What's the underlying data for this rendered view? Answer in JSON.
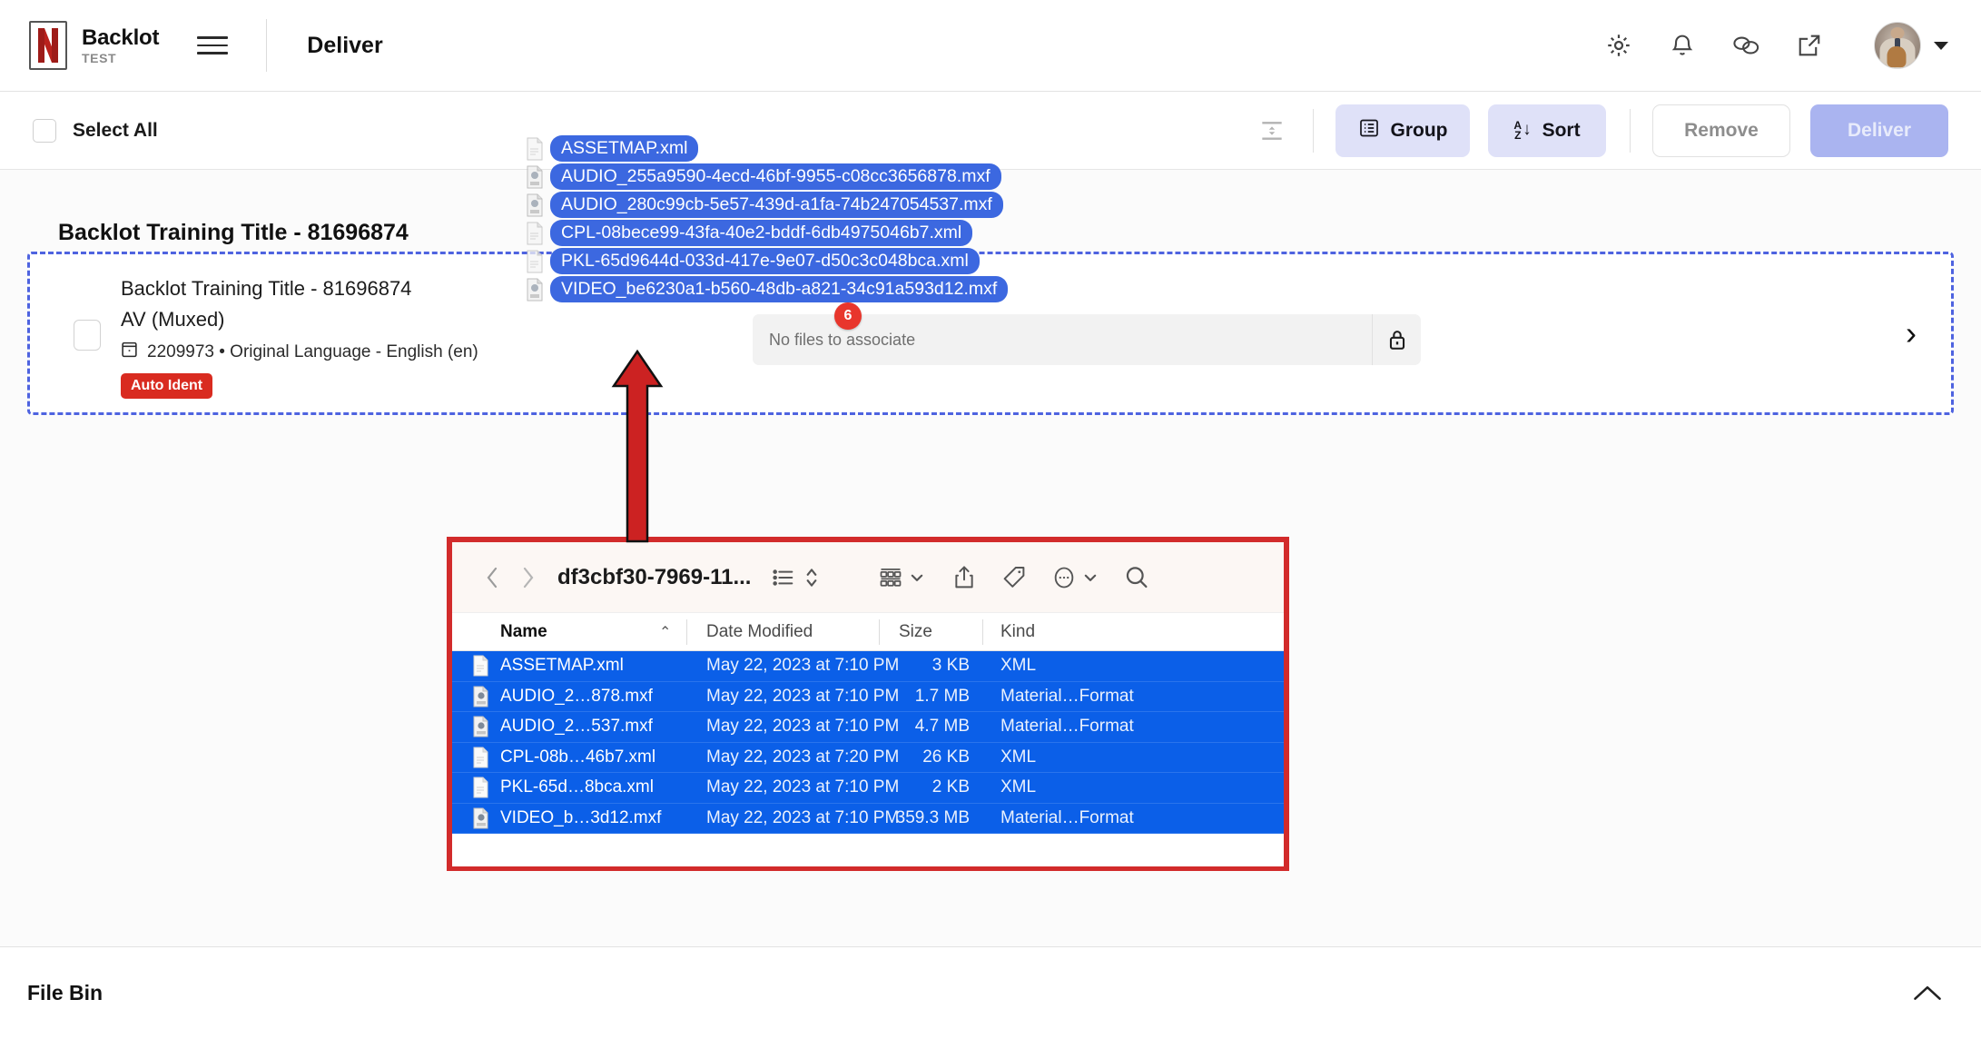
{
  "topnav": {
    "brand_name": "Backlot",
    "brand_sub": "TEST",
    "page_title": "Deliver",
    "icons": [
      "gear-icon",
      "bell-icon",
      "chat-icon",
      "external-link-icon"
    ]
  },
  "actionbar": {
    "select_all_label": "Select All",
    "filter_sort_icon": "collapse-expand-icon",
    "group_label": "Group",
    "sort_label": "Sort",
    "sort_glyph_top": "A",
    "sort_glyph_bottom": "Z",
    "sort_arrow": "↓",
    "remove_label": "Remove",
    "deliver_label": "Deliver",
    "colors": {
      "group_bg": "#dfe1f8",
      "sort_bg": "#dfe1f8",
      "deliver_bg": "#aab4f0",
      "deliver_text": "#e8ebfb"
    }
  },
  "main": {
    "group_title": "Backlot Training Title - 81696874",
    "asset": {
      "title": "Backlot Training Title - 81696874",
      "type": "AV (Muxed)",
      "meta": "2209973 • Original Language - English (en)",
      "meta_icon": "asset-id-icon",
      "badge": "Auto Ident",
      "badge_color": "#d92b20",
      "dropzone_text": "No files to associate",
      "dropzone_lock_icon": "lock-icon",
      "drag_count_badge": "6",
      "chevron": "›"
    },
    "drag_ghost": {
      "items": [
        {
          "name": "ASSETMAP.xml",
          "icon": "xml-file-icon"
        },
        {
          "name": "AUDIO_255a9590-4ecd-46bf-9955-c08cc3656878.mxf",
          "icon": "media-file-icon"
        },
        {
          "name": "AUDIO_280c99cb-5e57-439d-a1fa-74b247054537.mxf",
          "icon": "media-file-icon"
        },
        {
          "name": "CPL-08bece99-43fa-40e2-bddf-6db4975046b7.xml",
          "icon": "xml-file-icon"
        },
        {
          "name": "PKL-65d9644d-033d-417e-9e07-d50c3c048bca.xml",
          "icon": "xml-file-icon"
        },
        {
          "name": "VIDEO_be6230a1-b560-48db-a821-34c91a593d12.mxf",
          "icon": "media-file-icon"
        }
      ],
      "pill_color": "#3c68e0"
    }
  },
  "finder": {
    "title": "df3cbf30-7969-11...",
    "back_icon": "chevron-left-icon",
    "forward_icon": "chevron-right-icon",
    "toolbar_icons": [
      "list-view-icon",
      "sort-stepper-icon",
      "group-view-icon",
      "share-icon",
      "tag-icon",
      "more-actions-icon",
      "search-icon"
    ],
    "columns": [
      "Name",
      "Date Modified",
      "Size",
      "Kind"
    ],
    "sort_indicator": "⌃",
    "rows": [
      {
        "name": "ASSETMAP.xml",
        "date": "May 22, 2023 at 7:10 PM",
        "size": "3 KB",
        "kind": "XML",
        "icon": "xml-file-icon"
      },
      {
        "name": "AUDIO_2…878.mxf",
        "date": "May 22, 2023 at 7:10 PM",
        "size": "1.7 MB",
        "kind": "Material…Format",
        "icon": "media-file-icon"
      },
      {
        "name": "AUDIO_2…537.mxf",
        "date": "May 22, 2023 at 7:10 PM",
        "size": "4.7 MB",
        "kind": "Material…Format",
        "icon": "media-file-icon"
      },
      {
        "name": "CPL-08b…46b7.xml",
        "date": "May 22, 2023 at 7:20 PM",
        "size": "26 KB",
        "kind": "XML",
        "icon": "xml-file-icon"
      },
      {
        "name": "PKL-65d…8bca.xml",
        "date": "May 22, 2023 at 7:10 PM",
        "size": "2 KB",
        "kind": "XML",
        "icon": "xml-file-icon"
      },
      {
        "name": "VIDEO_b…3d12.mxf",
        "date": "May 22, 2023 at 7:10 PM",
        "size": "359.3 MB",
        "kind": "Material…Format",
        "icon": "media-file-icon"
      }
    ],
    "selection_color": "#0b5fe8",
    "outline_color": "#d22b2b"
  },
  "annotation": {
    "arrow_color": "#cc2222",
    "arrow_name": "red-up-arrow"
  },
  "filebin": {
    "label": "File Bin",
    "chevron": "collapse-chevron-up-icon"
  }
}
